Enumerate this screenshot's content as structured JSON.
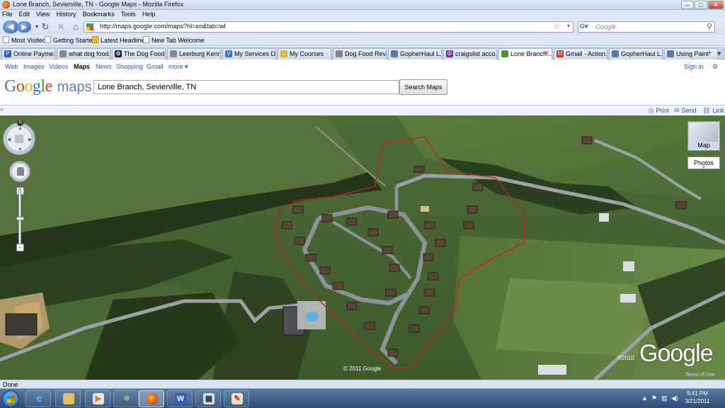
{
  "window": {
    "title": "Lone Branch, Sevierville, TN - Google Maps - Mozilla Firefox",
    "controls": {
      "minimize": "–",
      "maximize": "□",
      "close": "✕"
    }
  },
  "menu": [
    "File",
    "Edit",
    "View",
    "History",
    "Bookmarks",
    "Tools",
    "Help"
  ],
  "navigation": {
    "url": "http://maps.google.com/maps?hl=en&tab=wl",
    "search_engine": "Google",
    "search_placeholder": "Google"
  },
  "bookmarks": [
    "Most Visited",
    "Getting Started",
    "Latest Headlines",
    "New Tab Welcome"
  ],
  "tabs": [
    {
      "label": "Online Payme...",
      "icon_color": "#2a5aa8",
      "icon_char": "P"
    },
    {
      "label": "what dog food...",
      "icon_color": "#888888",
      "icon_char": ""
    },
    {
      "label": "The Dog Food ...",
      "icon_color": "#222222",
      "icon_char": "✿"
    },
    {
      "label": "Leerburg Kenn...",
      "icon_color": "#888888",
      "icon_char": ""
    },
    {
      "label": "My Services D...",
      "icon_color": "#3b6fc1",
      "icon_char": "V"
    },
    {
      "label": "My Courses",
      "icon_color": "#e0b020",
      "icon_char": "☺"
    },
    {
      "label": "Dog Food Revi...",
      "icon_color": "#888888",
      "icon_char": ""
    },
    {
      "label": "GopherHaul L...",
      "icon_color": "#5a7aa3",
      "icon_char": ""
    },
    {
      "label": "craigslist acco...",
      "icon_color": "#7b2d8b",
      "icon_char": "☮"
    },
    {
      "label": "Lone Branch...",
      "icon_color": "#4a8f3c",
      "icon_char": ""
    },
    {
      "label": "Gmail - Action...",
      "icon_color": "#c0392b",
      "icon_char": "M"
    },
    {
      "label": "GopherHaul L...",
      "icon_color": "#5a7aa3",
      "icon_char": ""
    },
    {
      "label": "Using Paint",
      "icon_color": "#5a7aa3",
      "icon_char": ""
    }
  ],
  "active_tab_index": 9,
  "gbar": {
    "links": [
      "Web",
      "Images",
      "Videos",
      "Maps",
      "News",
      "Shopping",
      "Gmail",
      "more ▾"
    ],
    "selected": "Maps",
    "sign_in": "Sign in"
  },
  "logo": {
    "google": "Google",
    "maps": "maps"
  },
  "search": {
    "query": "Lone Branch, Sevierville, TN",
    "button": "Search Maps"
  },
  "tools": {
    "print": "Print",
    "send": "Send",
    "link": "Link"
  },
  "map": {
    "type_button": "Map",
    "photos_button": "Photos",
    "copyright_imagery": "© 2011 Google",
    "copyright_logo": "©2010",
    "logo_text": "Google",
    "terms": "Terms of Use",
    "compass_label": "N"
  },
  "status": "Done",
  "clock": {
    "time": "9:41 PM",
    "date": "3/21/2011"
  },
  "colors": {
    "accent": "#2a5aa8",
    "boundary": "#c0281e",
    "road": "#9aa3a8"
  }
}
